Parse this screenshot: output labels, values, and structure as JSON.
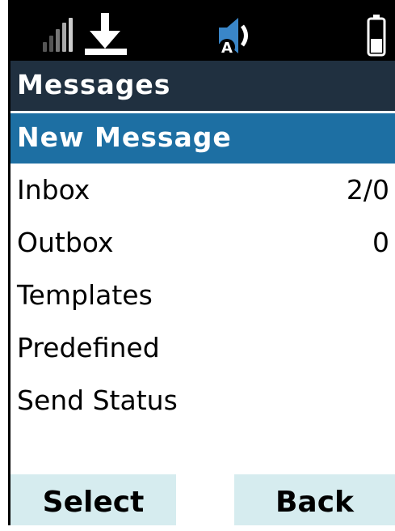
{
  "status_bar": {
    "icons": [
      "signal-strength-icon",
      "download-icon",
      "speaker-icon",
      "battery-icon"
    ],
    "speaker_badge": "A"
  },
  "title": "Messages",
  "menu": {
    "items": [
      {
        "label": "New Message",
        "count": "",
        "selected": true
      },
      {
        "label": "Inbox",
        "count": "2/0",
        "selected": false
      },
      {
        "label": "Outbox",
        "count": "0",
        "selected": false
      },
      {
        "label": "Templates",
        "count": "",
        "selected": false
      },
      {
        "label": "Predefined",
        "count": "",
        "selected": false
      },
      {
        "label": "Send Status",
        "count": "",
        "selected": false
      }
    ]
  },
  "softkeys": {
    "left": "Select",
    "right": "Back"
  },
  "colors": {
    "status_bar_bg": "#000000",
    "title_bar_bg": "#203040",
    "selection_bg": "#1d6fa3",
    "softkey_bg": "#d6ecef"
  }
}
